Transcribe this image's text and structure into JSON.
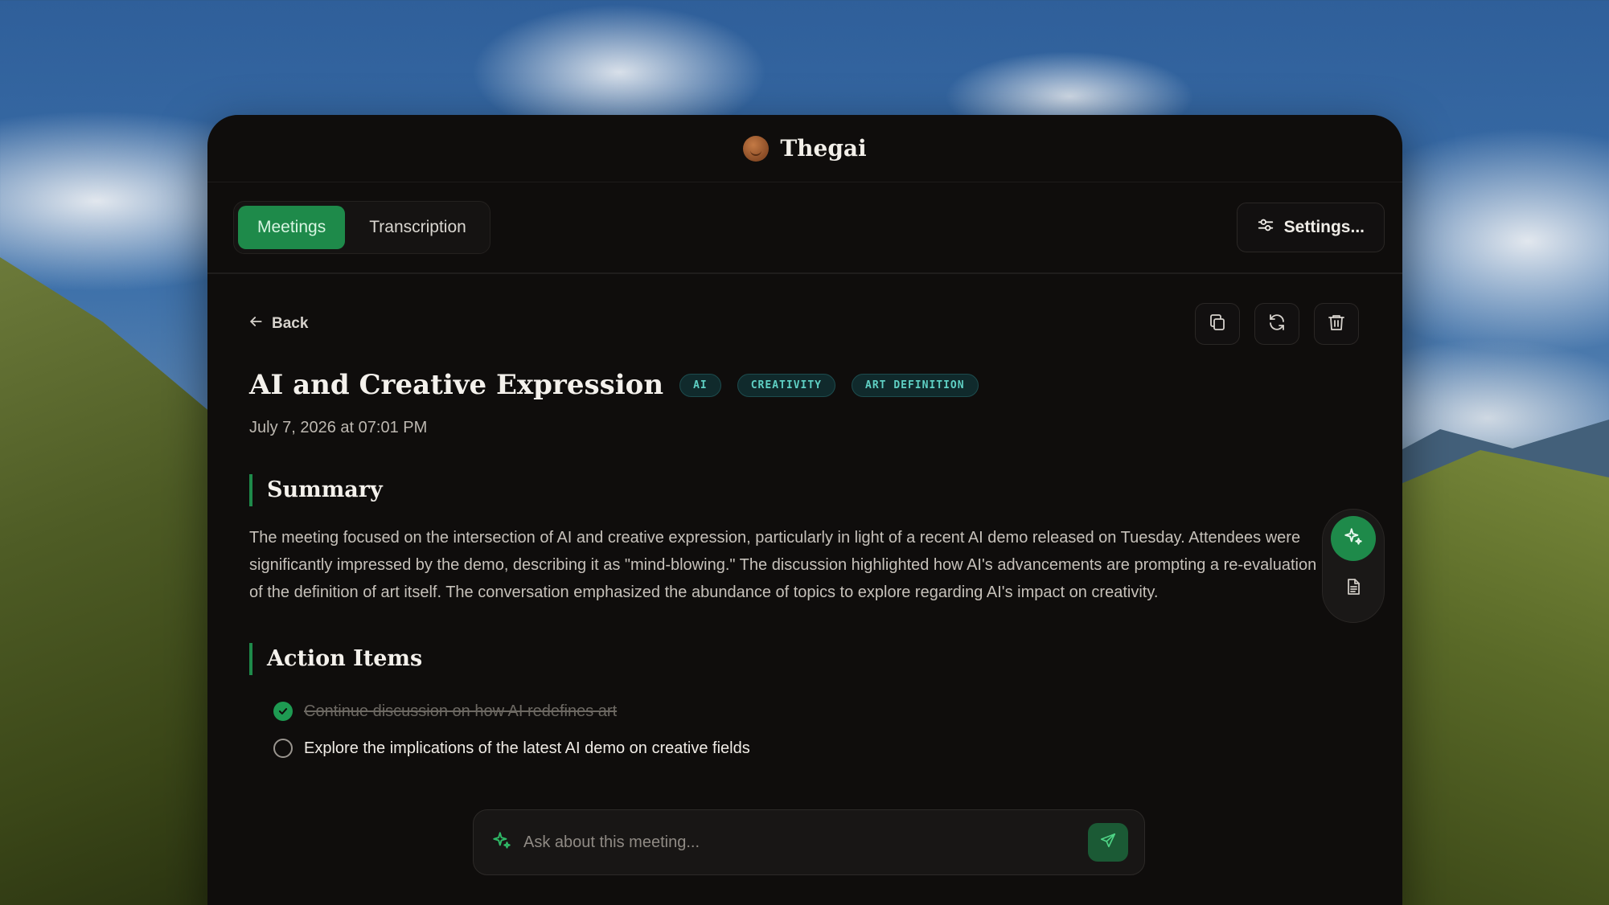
{
  "app": {
    "brand": "Thegai",
    "logo_icon": "avatar-icon"
  },
  "nav": {
    "tabs": [
      {
        "label": "Meetings",
        "active": true
      },
      {
        "label": "Transcription",
        "active": false
      }
    ],
    "settings_label": "Settings..."
  },
  "meeting": {
    "back_label": "Back",
    "title": "AI and Creative Expression",
    "tags": [
      "AI",
      "CREATIVITY",
      "ART DEFINITION"
    ],
    "date": "July 7, 2026 at 07:01 PM",
    "actions": [
      "copy-icon",
      "refresh-icon",
      "trash-icon"
    ]
  },
  "summary": {
    "heading": "Summary",
    "text": "The meeting focused on the intersection of AI and creative expression, particularly in light of a recent AI demo released on Tuesday. Attendees were significantly impressed by the demo, describing it as \"mind-blowing.\" The discussion highlighted how AI's advancements are prompting a re-evaluation of the definition of art itself. The conversation emphasized the abundance of topics to explore regarding AI's impact on creativity."
  },
  "action_items": {
    "heading": "Action Items",
    "items": [
      {
        "text": "Continue discussion on how AI redefines art",
        "done": true
      },
      {
        "text": "Explore the implications of the latest AI demo on creative fields",
        "done": false
      }
    ]
  },
  "ask": {
    "placeholder": "Ask about this meeting..."
  },
  "colors": {
    "accent": "#1e8a4a",
    "tag_text": "#5fd0c4",
    "panel_bg": "#0f0d0c"
  }
}
